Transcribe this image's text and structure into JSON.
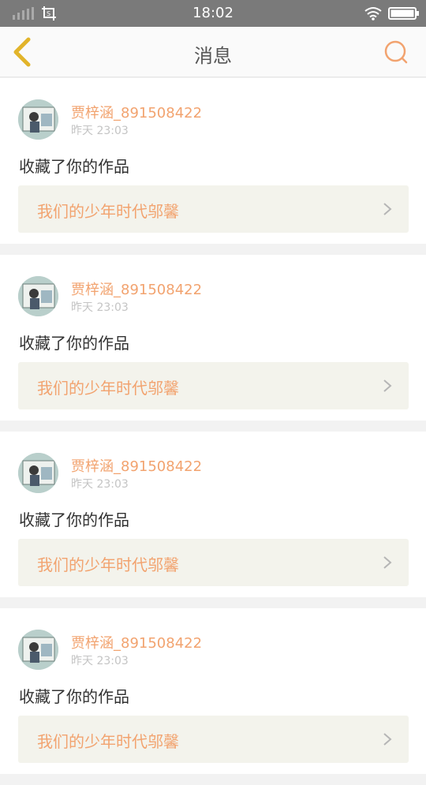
{
  "status_bar": {
    "time": "18:02"
  },
  "header": {
    "title": "消息",
    "icons": {
      "back": "chevron-left-icon",
      "search": "search-icon"
    },
    "accent_color": "#f2a36f",
    "back_color": "#e2b42a"
  },
  "messages": [
    {
      "username": "贾梓涵_891508422",
      "time": "昨天 23:03",
      "action": "收藏了你的作品",
      "work_title": "我们的少年时代邬馨"
    },
    {
      "username": "贾梓涵_891508422",
      "time": "昨天 23:03",
      "action": "收藏了你的作品",
      "work_title": "我们的少年时代邬馨"
    },
    {
      "username": "贾梓涵_891508422",
      "time": "昨天 23:03",
      "action": "收藏了你的作品",
      "work_title": "我们的少年时代邬馨"
    },
    {
      "username": "贾梓涵_891508422",
      "time": "昨天 23:03",
      "action": "收藏了你的作品",
      "work_title": "我们的少年时代邬馨"
    }
  ]
}
